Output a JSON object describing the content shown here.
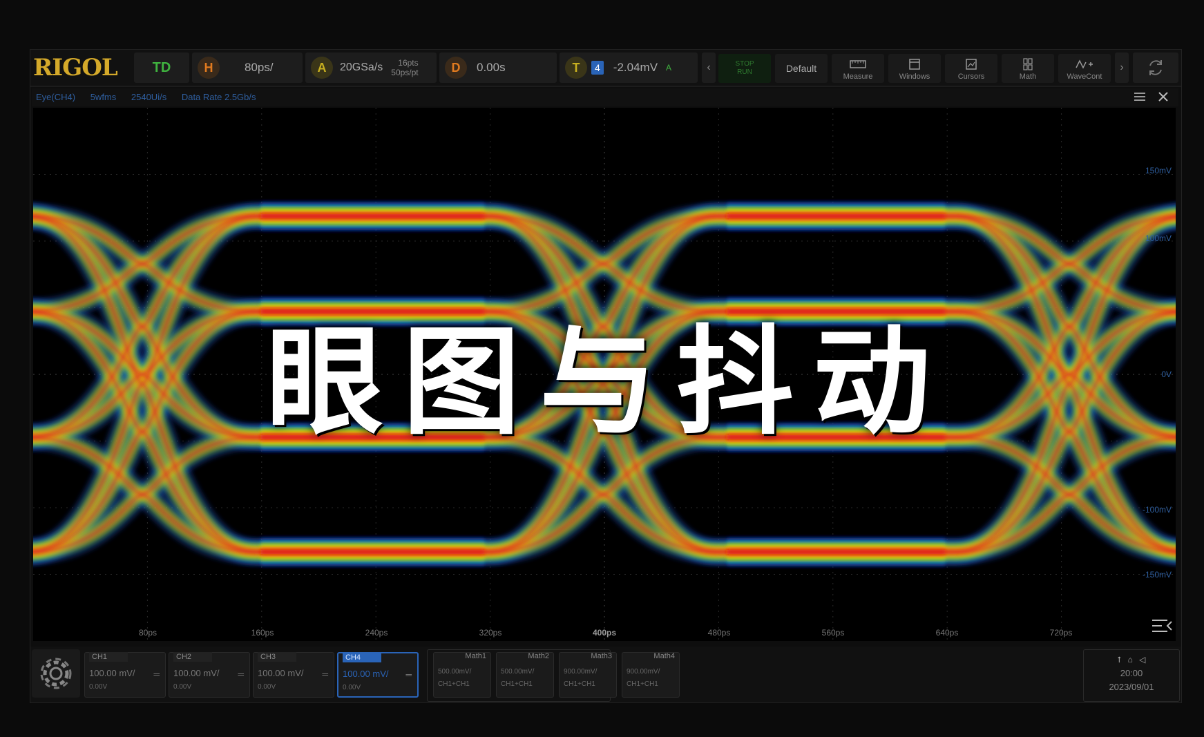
{
  "top_bar": {
    "logo": "RIGOL",
    "mode": "TD",
    "horizontal": {
      "icon_letter": "H",
      "value": "80ps/"
    },
    "acquire": {
      "icon_letter": "A",
      "rate": "20GSa/s",
      "pts": "16pts",
      "ps_per_pt": "50ps/pt"
    },
    "delay": {
      "icon_letter": "D",
      "value": "0.00s"
    },
    "trigger": {
      "icon_letter": "T",
      "channel": "4",
      "level": "-2.04mV",
      "edge": "A"
    },
    "run": {
      "line1": "STOP",
      "line2": "RUN"
    },
    "menu": [
      {
        "label": "Default",
        "icon": "default-icon"
      },
      {
        "label": "Measure",
        "icon": "measure-icon"
      },
      {
        "label": "Windows",
        "icon": "windows-icon"
      },
      {
        "label": "Cursors",
        "icon": "cursors-icon"
      },
      {
        "label": "Math",
        "icon": "math-icon"
      },
      {
        "label": "WaveCont",
        "icon": "wavecont-icon"
      }
    ]
  },
  "plot_header": {
    "items": [
      "Eye(CH4)",
      "5wfms",
      "2540Ui/s",
      "Data Rate 2.5Gb/s"
    ]
  },
  "plot": {
    "y_labels": [
      "150mV",
      "100mV",
      "0V",
      "-100mV",
      "-150mV"
    ],
    "x_labels": [
      "80ps",
      "160ps",
      "240ps",
      "320ps",
      "400ps",
      "480ps",
      "560ps",
      "640ps",
      "720ps"
    ]
  },
  "overlay_title": "眼图与抖动",
  "channels": [
    {
      "name": "CH1",
      "scale": "100.00 mV/",
      "offset": "0.00V"
    },
    {
      "name": "CH2",
      "scale": "100.00 mV/",
      "offset": "0.00V"
    },
    {
      "name": "CH3",
      "scale": "100.00 mV/",
      "offset": "0.00V"
    },
    {
      "name": "CH4",
      "scale": "100.00 mV/",
      "offset": "0.00V"
    }
  ],
  "math": [
    {
      "name": "Math1",
      "scale": "500.00mV/",
      "expr": "CH1+CH1"
    },
    {
      "name": "Math2",
      "scale": "500.00mV/",
      "expr": "CH1+CH1"
    },
    {
      "name": "Math3",
      "scale": "900.00mV/",
      "expr": "CH1+CH1"
    },
    {
      "name": "Math4",
      "scale": "900.00mV/",
      "expr": "CH1+CH1"
    }
  ],
  "clock": {
    "time": "20:00",
    "date": "2023/09/01"
  },
  "colors": {
    "logo": "#d4a92a",
    "mode": "#3fb23f",
    "horizontal": "#e07a1f",
    "acquire": "#c8b020",
    "delay": "#e07a1f",
    "trigger": "#c8b020",
    "ch4": "#2a64b8"
  }
}
